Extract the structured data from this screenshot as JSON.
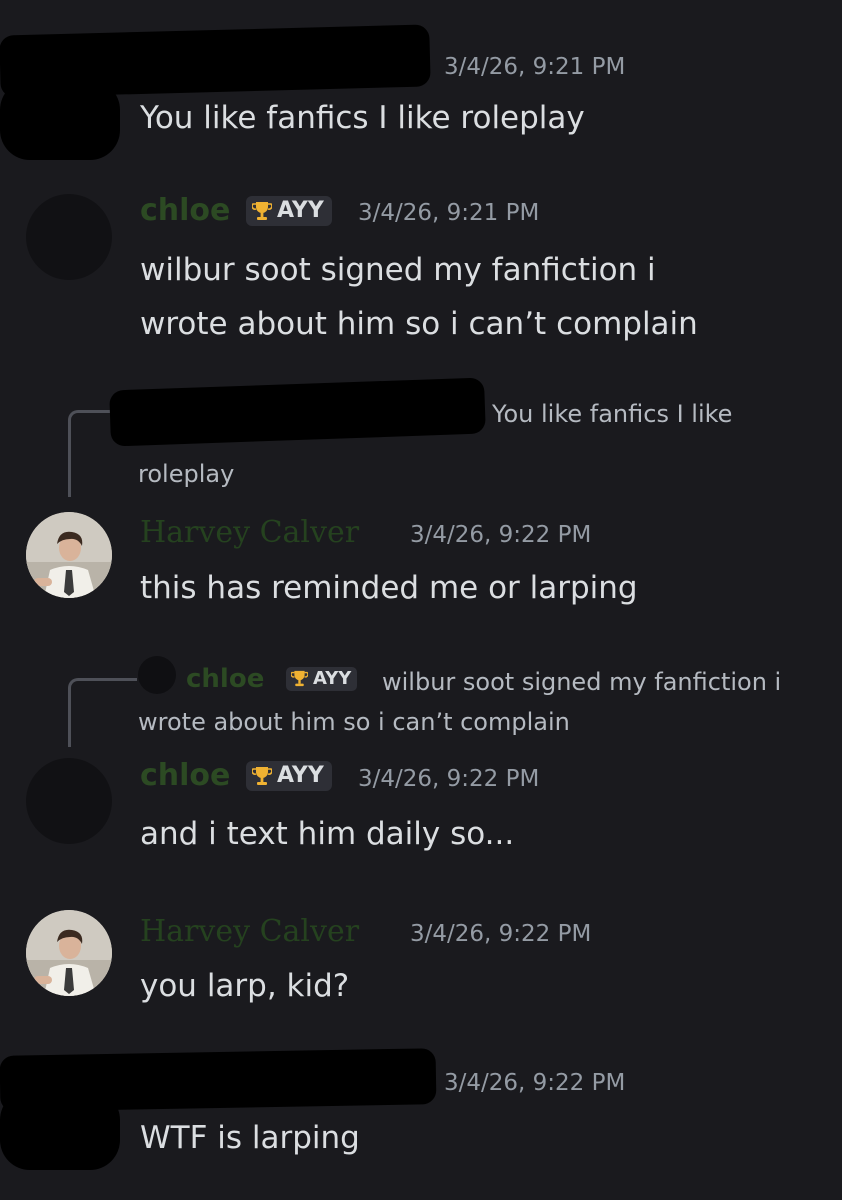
{
  "messages": [
    {
      "author": "",
      "timestamp": "3/4/26, 9:21 PM",
      "text": "You like fanfics I like roleplay"
    },
    {
      "author": "chloe",
      "badge": "AYY",
      "timestamp": "3/4/26, 9:21 PM",
      "lines": [
        "wilbur soot signed my fanfiction i",
        "wrote about him so i can’t complain"
      ]
    },
    {
      "reply_preview": {
        "line1": "You like fanfics I like",
        "line2": "roleplay"
      },
      "author": "Harvey Calver",
      "timestamp": "3/4/26, 9:22 PM",
      "text": "this has reminded me or larping"
    },
    {
      "reply_preview": {
        "author": "chloe",
        "badge": "AYY",
        "line1": "wilbur soot signed my fanfiction i",
        "line2": "wrote about him so i can’t complain"
      },
      "author": "chloe",
      "badge": "AYY",
      "timestamp": "3/4/26, 9:22 PM",
      "text": "and i text him daily so..."
    },
    {
      "author": "Harvey Calver",
      "timestamp": "3/4/26, 9:22 PM",
      "text": "you larp, kid?"
    },
    {
      "author": "",
      "timestamp": "3/4/26, 9:22 PM",
      "text": "WTF is larping"
    }
  ],
  "colors": {
    "background": "#1a1a1e",
    "chloe_name": "#2c4a23",
    "harvey_name": "#25421f",
    "badge_bg": "#2e2f36",
    "timestamp": "#949ba4",
    "trophy": "#f0b232"
  },
  "icons": {
    "badge_icon": "trophy-icon"
  }
}
